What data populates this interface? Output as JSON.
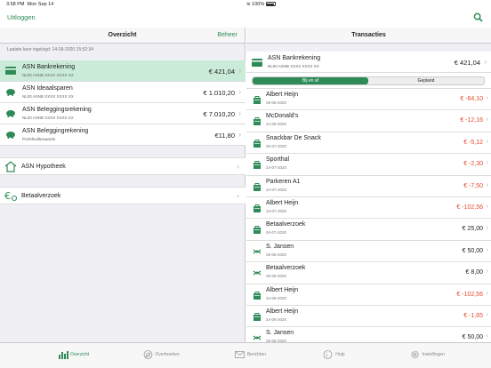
{
  "status": {
    "time": "3:58 PM",
    "date": "Mon Sep 14",
    "battery": "100%"
  },
  "nav": {
    "logout": "Uitloggen"
  },
  "overview": {
    "title": "Overzicht",
    "manage": "Beheer",
    "last_login": "Laatste keer ingelogd: 14-09-2020 15:52:34",
    "accounts": [
      {
        "name": "ASN Bankrekening",
        "number": "NL00 ASNB XXXX XXXX XX",
        "amount": "€ 421,04"
      },
      {
        "name": "ASN Ideaalsparen",
        "number": "NL00 ASNB XXXX XXXX XX",
        "amount": "€ 1.010,20"
      },
      {
        "name": "ASN Beleggingsrekening",
        "number": "NL00 ASNB XXXX XXXX XX",
        "amount": "€ 7.010,20"
      },
      {
        "name": "ASN Beleggingrekening",
        "number": "Portefeuillewaarde",
        "amount": "€11,80"
      }
    ],
    "mortgage": "ASN Hypotheek",
    "payment_request": "Betaalverzoek"
  },
  "transactions": {
    "title": "Transacties",
    "account": {
      "name": "ASN Bankrekening",
      "number": "NL00 ASNB XXXX XXXX XX",
      "amount": "€ 421,04"
    },
    "segments": [
      "Bij en af",
      "Gepland"
    ],
    "items": [
      {
        "name": "Albert Heijn",
        "date": "26-08-2020",
        "amount": "€ -64,10",
        "neg": true,
        "icon": "shopping-bag-icon"
      },
      {
        "name": "McDonald's",
        "date": "24-08-2020",
        "amount": "€ -12,16",
        "neg": true,
        "icon": "shopping-bag-icon"
      },
      {
        "name": "Snackbar De Snack",
        "date": "30-07-2020",
        "amount": "€ -5,12",
        "neg": true,
        "icon": "shopping-bag-icon"
      },
      {
        "name": "Sporthal",
        "date": "24-07-2020",
        "amount": "€ -2,30",
        "neg": true,
        "icon": "shopping-bag-icon"
      },
      {
        "name": "Parkeren A1",
        "date": "24-07-2020",
        "amount": "€ -7,50",
        "neg": true,
        "icon": "shopping-bag-icon"
      },
      {
        "name": "Albert Heijn",
        "date": "23-07-2020",
        "amount": "€ -102,56",
        "neg": true,
        "icon": "shopping-bag-icon"
      },
      {
        "name": "Betaalverzoek",
        "date": "04-07-2020",
        "amount": "€ 25,00",
        "neg": false,
        "icon": "shopping-bag-icon"
      },
      {
        "name": "S. Jansen",
        "date": "25-06-2020",
        "amount": "€ 50,00",
        "neg": false,
        "icon": "transfer-arrows-icon"
      },
      {
        "name": "Betaalverzoek",
        "date": "26-06-2020",
        "amount": "€ 8,00",
        "neg": false,
        "icon": "transfer-arrows-icon"
      },
      {
        "name": "Albert Heijn",
        "date": "24-06-2020",
        "amount": "€ -102,56",
        "neg": true,
        "icon": "shopping-bag-icon"
      },
      {
        "name": "Albert Heijn",
        "date": "24-06-2020",
        "amount": "€ -1,65",
        "neg": true,
        "icon": "shopping-bag-icon"
      },
      {
        "name": "S. Jansen",
        "date": "25-06-2020",
        "amount": "€ 50,00",
        "neg": false,
        "icon": "transfer-arrows-icon"
      }
    ]
  },
  "tabs": [
    {
      "label": "Overzicht",
      "icon": "bar-chart-icon",
      "active": true
    },
    {
      "label": "Overboeken",
      "icon": "transfer-icon",
      "active": false
    },
    {
      "label": "Berichten",
      "icon": "envelope-icon",
      "active": false
    },
    {
      "label": "Hulp",
      "icon": "help-icon",
      "active": false
    },
    {
      "label": "Instellingen",
      "icon": "gear-icon",
      "active": false
    }
  ],
  "colors": {
    "accent": "#2e8b57",
    "selected": "#c9ebd8",
    "negative": "#e64a2e"
  }
}
